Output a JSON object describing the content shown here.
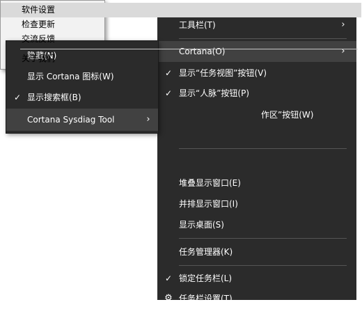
{
  "main_menu": {
    "toolbars": "工具栏(T)",
    "cortana": "Cortana(O)",
    "show_task_view": "显示“任务视图”按钮(V)",
    "show_people": "显示“人脉”按钮(P)",
    "ink_workspace_partial": "作区”按钮(W)",
    "cascade": "堆叠显示窗口(E)",
    "side_by_side": "并排显示窗口(I)",
    "show_desktop": "显示桌面(S)",
    "task_manager": "任务管理器(K)",
    "lock_taskbar": "锁定任务栏(L)",
    "taskbar_settings": "任务栏设置(T)"
  },
  "cortana_menu": {
    "hidden": "隐藏(N)",
    "show_icon": "显示 Cortana 图标(W)",
    "show_search_box": "显示搜索框(B)",
    "sysdiag": "Cortana Sysdiag Tool"
  },
  "tool_menu": {
    "settings": "软件设置",
    "check_update": "检查更新",
    "feedback": "交流反馈",
    "about": "关于我们"
  },
  "glyphs": {
    "check": "✓",
    "chevron": "›",
    "gear": "⚙"
  },
  "colors": {
    "menu_bg": "#2b2b2b",
    "menu_highlight": "#414141",
    "light_menu_bg": "#f2f2f2",
    "light_highlight": "#dadada"
  }
}
